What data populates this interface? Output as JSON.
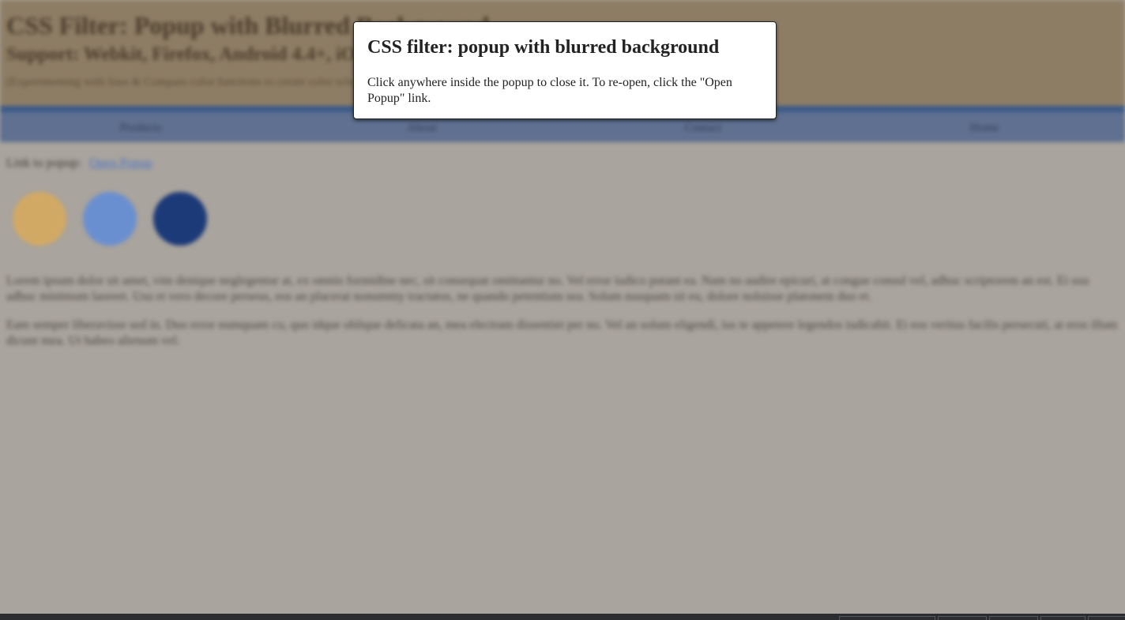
{
  "background": {
    "title": "CSS Filter: Popup with Blurred Background",
    "subtitle": "Support: Webkit, Firefox, Android 4.4+, iOS 6+, Edge 17+",
    "description": "(Experimenting with Sass & Compass color functions to create color schemes)",
    "nav": [
      "Products",
      "About",
      "Contact",
      "Home"
    ],
    "link_label": "Link to popup:",
    "link_text": "Open Popup",
    "circles": [
      "#d2a964",
      "#6a8fd0",
      "#1c3a78"
    ],
    "paragraphs": [
      "Lorem ipsum dolor sit amet, vim denique neglegentur at, ex omnis formidine nec, sit consequat omittantur no. Vel error iudico putant ea. Nam no audire epicuri, at congue consul vel, adhuc scriptorem an est. Ei usu adhuc minimum laoreet. Usu et vero decore perseus, eos an placerat nonummy tractatos, ne quando petentium sea. Solum nusquam sit eu, dolore noluisse platonem duo et.",
      "Eam semper liberavisse sed in. Duo error numquam cu, quo idque oblique delicata an, mea electram dissentiet per no. Vel an solum eligendi, ius te appetere legendos iudicabit. Ei eos veritus facilis persecuti, at eros illum dicunt mea. Ut habeo alienum vel."
    ]
  },
  "popup": {
    "title": "CSS filter: popup with blurred background",
    "body": "Click anywhere inside the popup to close it. To re-open, click the \"Open Popup\" link."
  },
  "colors": {
    "header_bg": "#8e7d65",
    "nav_bg": "#5f7090",
    "page_bg": "#a9a49d",
    "popup_bg": "#ffffff"
  }
}
